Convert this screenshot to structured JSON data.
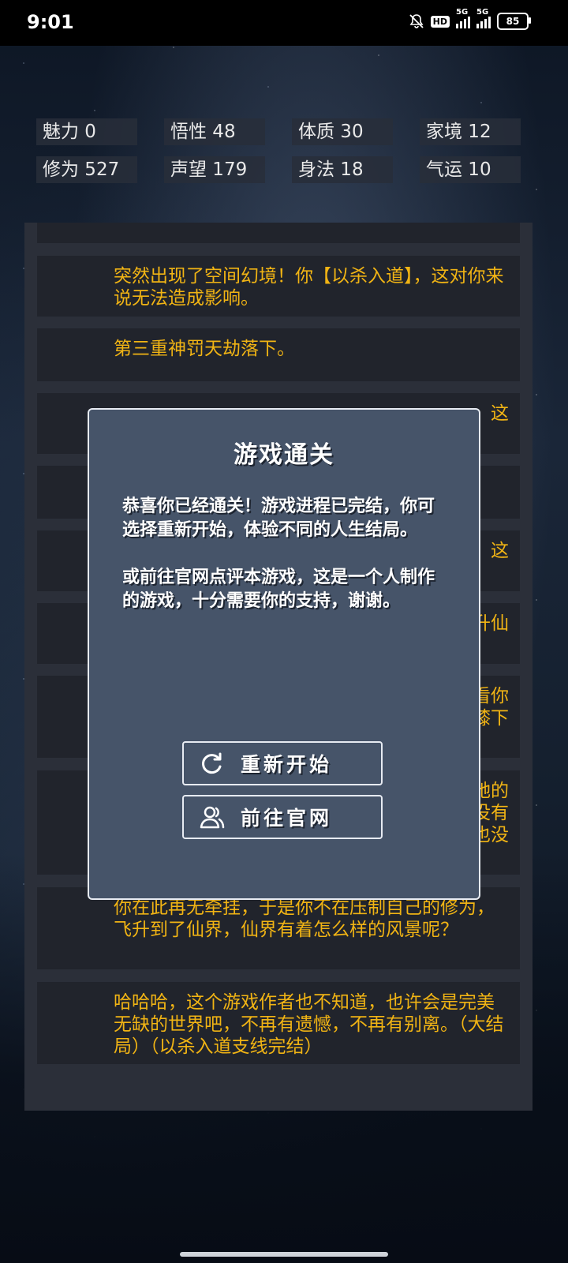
{
  "status_bar": {
    "time": "9:01",
    "hd": "HD",
    "signal1_tag": "5G",
    "signal2_tag": "5G",
    "battery": "85"
  },
  "stats": [
    {
      "label": "魅力 0"
    },
    {
      "label": "悟性 48"
    },
    {
      "label": "体质 30"
    },
    {
      "label": "家境 12"
    },
    {
      "label": "修为 527"
    },
    {
      "label": "声望 179"
    },
    {
      "label": "身法 18"
    },
    {
      "label": "气运 10"
    }
  ],
  "log": {
    "items": [
      {
        "text": ""
      },
      {
        "text": "突然出现了空间幻境！你【以杀入道】，这对你来说无法造成影响。"
      },
      {
        "text": "第三重神罚天劫落下。"
      },
      {
        "text": "，这"
      },
      {
        "text": ""
      },
      {
        "text": "，这"
      },
      {
        "text": "升仙"
      },
      {
        "text": "看你\n膝下"
      },
      {
        "text": "她的\n没有\n也没"
      },
      {
        "text": "你在此再无牵挂，于是你不在压制自己的修为，飞升到了仙界，仙界有着怎么样的风景呢？"
      },
      {
        "text": "哈哈哈，这个游戏作者也不知道，也许会是完美无缺的世界吧，不再有遗憾，不再有别离。（大结局）（以杀入道支线完结）"
      }
    ]
  },
  "dialog": {
    "title": "游戏通关",
    "paragraph1": "恭喜你已经通关！游戏进程已完结，你可选择重新开始，体验不同的人生结局。",
    "paragraph2": "或前往官网点评本游戏，这是一个人制作的游戏，十分需要你的支持，谢谢。",
    "restart_label": "重新开始",
    "website_label": "前往官网"
  }
}
